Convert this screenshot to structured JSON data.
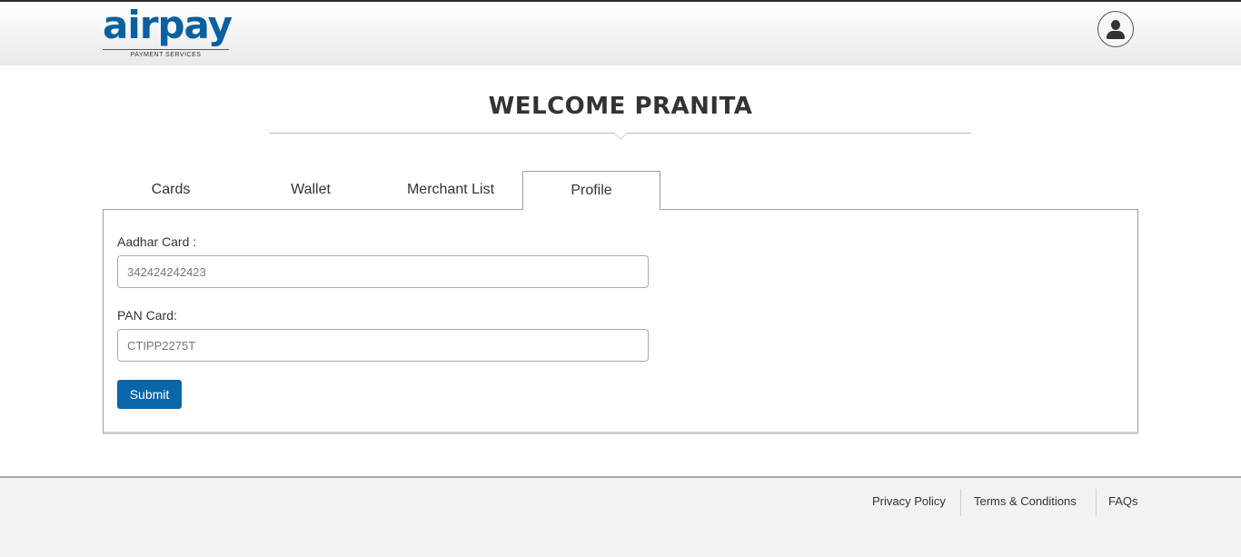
{
  "header": {
    "logo_text": "airpay",
    "logo_tagline": "PAYMENT SERVICES",
    "brand_color": "#0a5f9e",
    "profile_icon": "user-icon"
  },
  "welcome": {
    "title": "WELCOME PRANITA"
  },
  "tabs": [
    {
      "label": "Cards",
      "active": false
    },
    {
      "label": "Wallet",
      "active": false
    },
    {
      "label": "Merchant List",
      "active": false
    },
    {
      "label": "Profile",
      "active": true
    }
  ],
  "profile_form": {
    "aadhar_label": "Aadhar Card :",
    "aadhar_value": "342424242423",
    "pan_label": "PAN Card:",
    "pan_value": "CTIPP2275T",
    "submit_label": "Submit",
    "button_color": "#0a66a8"
  },
  "footer": {
    "links": [
      "Privacy Policy",
      "Terms & Conditions",
      "FAQs"
    ]
  }
}
